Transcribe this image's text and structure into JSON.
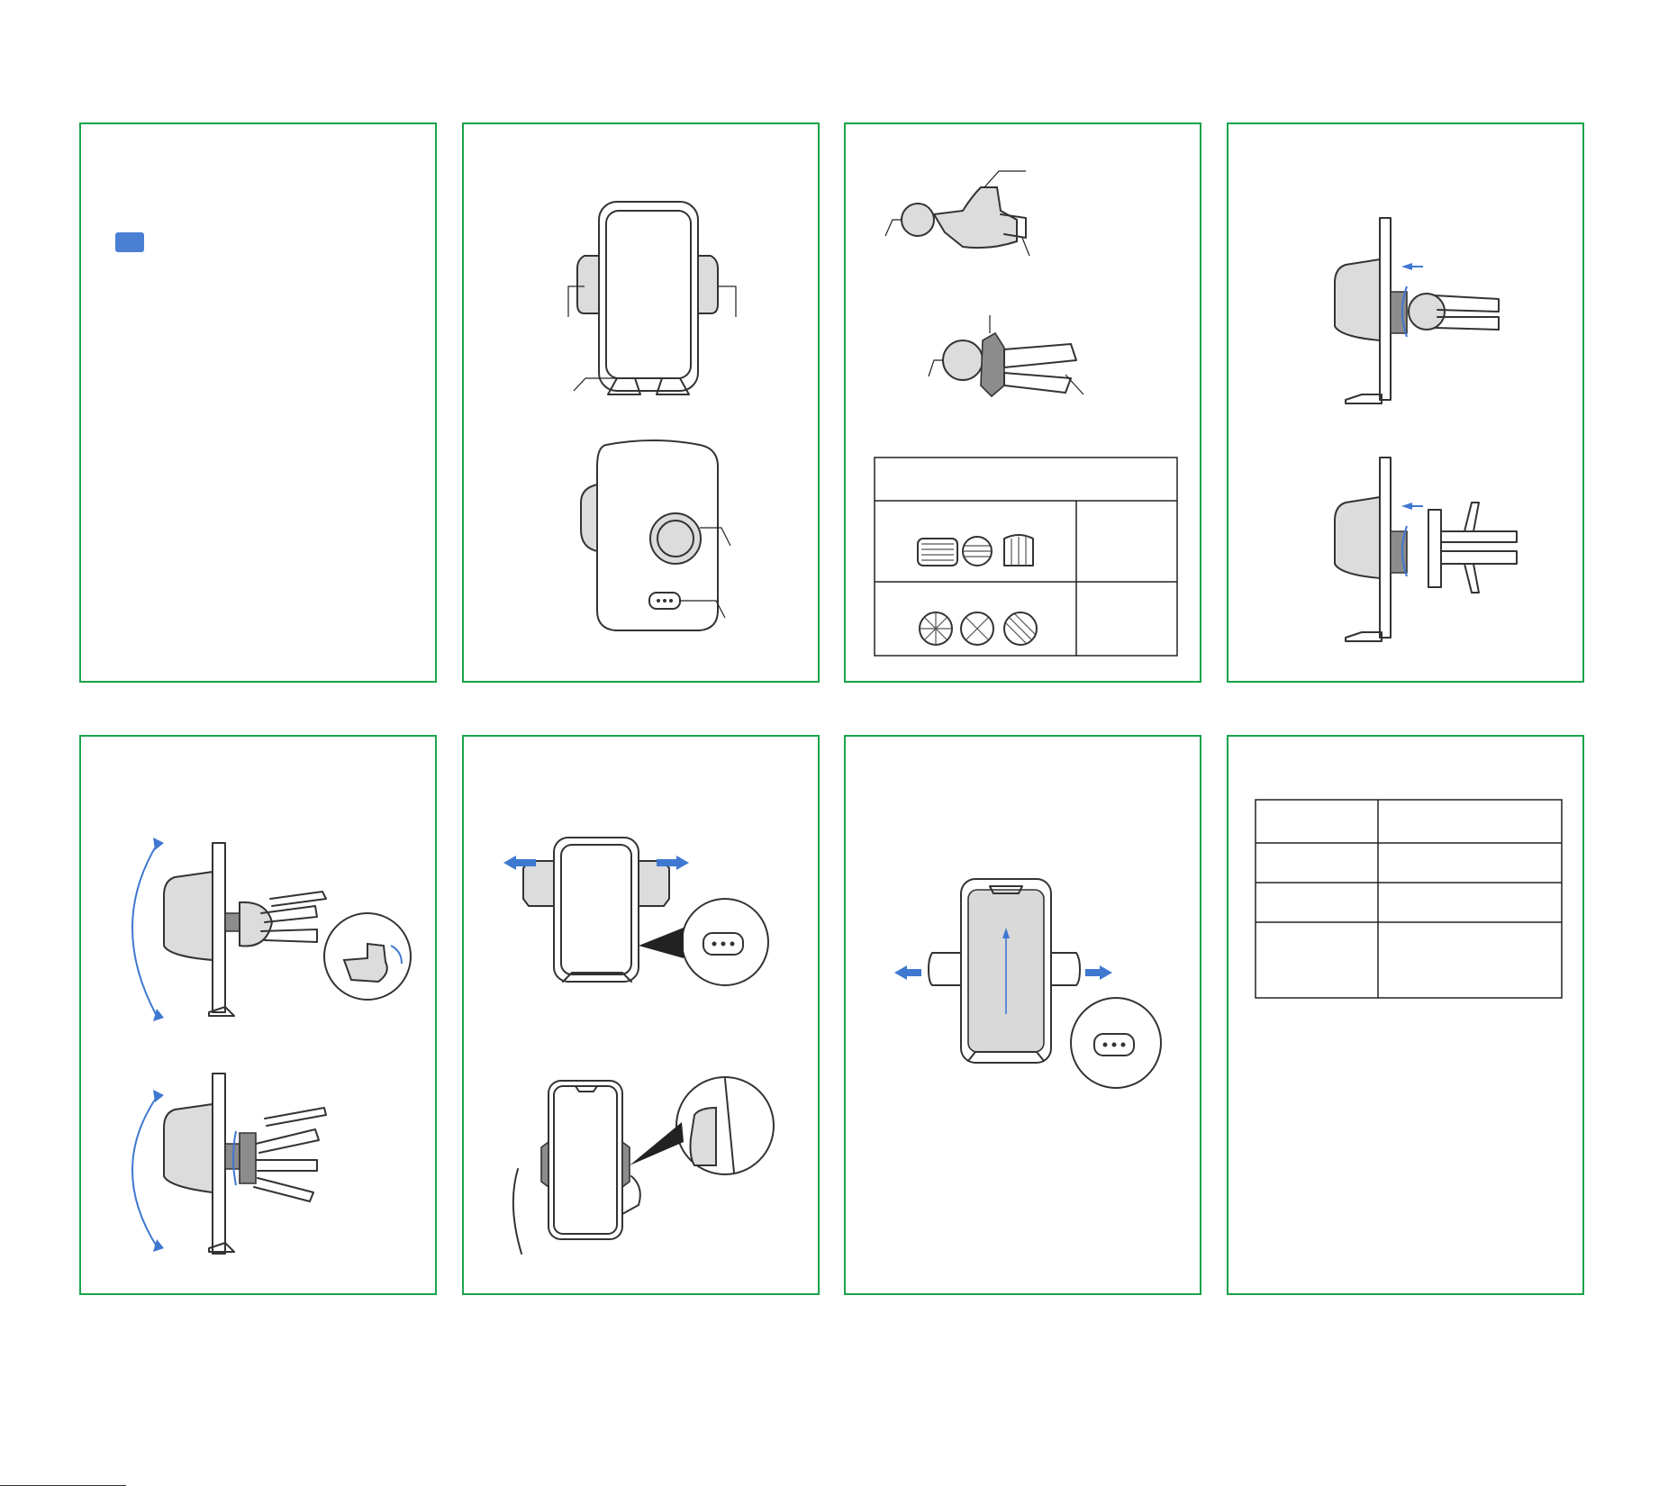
{
  "document": {
    "panels": [
      {
        "id": "cover",
        "badge_color": "#4a7fd4"
      },
      {
        "id": "parts-front-back"
      },
      {
        "id": "vent-clips",
        "table": {
          "rows": 3,
          "cols": 2
        }
      },
      {
        "id": "install-vent"
      },
      {
        "id": "adjust-angle"
      },
      {
        "id": "open-arms"
      },
      {
        "id": "release-phone"
      },
      {
        "id": "specs",
        "table": {
          "rows": 4,
          "cols": 2
        }
      }
    ],
    "colors": {
      "border": "#1aa34a",
      "accent": "#3f78d0"
    }
  }
}
